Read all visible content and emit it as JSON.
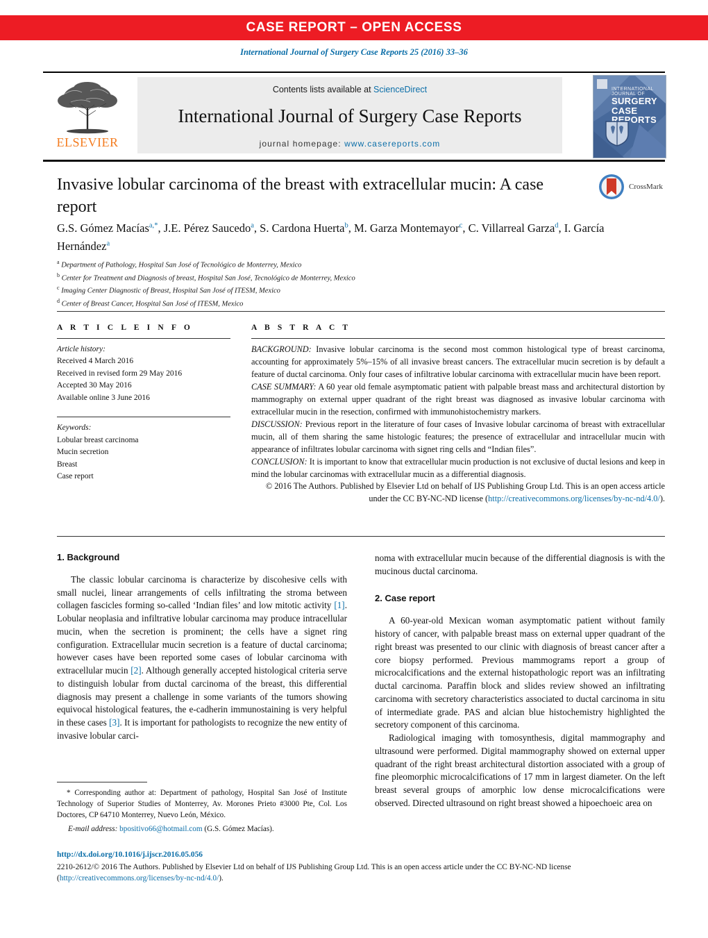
{
  "banner": {
    "text": "CASE REPORT – OPEN ACCESS"
  },
  "journal_ref": "International Journal of Surgery Case Reports 25 (2016) 33–36",
  "masthead": {
    "publisher_name": "ELSEVIER",
    "contents_prefix": "Contents lists available at ",
    "contents_link": "ScienceDirect",
    "journal_name": "International Journal of Surgery Case Reports",
    "homepage_prefix": "journal homepage: ",
    "homepage_link": "www.casereports.com",
    "cover": {
      "line1": "INTERNATIONAL",
      "line2": "JOURNAL OF",
      "line3": "SURGERY",
      "line4": "CASE",
      "line5": "REPORTS"
    }
  },
  "article": {
    "title": "Invasive lobular carcinoma of the breast with extracellular mucin: A case report",
    "crossmark_label": "CrossMark",
    "authors_html": "G.S. Gómez Macías<sup>a,</sup><sup>*</sup>, J.E. Pérez Saucedo<sup>a</sup>, S. Cardona Huerta<sup>b</sup>, M. Garza Montemayor<sup>c</sup>, C. Villarreal Garza<sup>d</sup>, I. García Hernández<sup>a</sup>",
    "affiliations": [
      {
        "marker": "a",
        "text": "Department of Pathology, Hospital San José of Tecnológico de Monterrey, Mexico"
      },
      {
        "marker": "b",
        "text": "Center for Treatment and Diagnosis of breast, Hospital San José, Tecnológico de Monterrey, Mexico"
      },
      {
        "marker": "c",
        "text": "Imaging Center Diagnostic of Breast, Hospital San José of ITESM, Mexico"
      },
      {
        "marker": "d",
        "text": "Center of Breast Cancer, Hospital San José of ITESM, Mexico"
      }
    ]
  },
  "article_info": {
    "heading": "A R T I C L E    I N F O",
    "history_label": "Article history:",
    "history": [
      "Received 4 March 2016",
      "Received in revised form 29 May 2016",
      "Accepted 30 May 2016",
      "Available online 3 June 2016"
    ],
    "keywords_label": "Keywords:",
    "keywords": [
      "Lobular breast carcinoma",
      "Mucin secretion",
      "Breast",
      "Case report"
    ]
  },
  "abstract": {
    "heading": "A B S T R A C T",
    "background_tag": "BACKGROUND:",
    "background_text": " Invasive lobular carcinoma is the second most common histological type of breast carcinoma, accounting for approximately 5%–15% of all invasive breast cancers. The extracellular mucin secretion is by default a feature of ductal carcinoma. Only four cases of infiltrative lobular carcinoma with extracellular mucin have been report.",
    "case_summary_tag": "CASE SUMMARY:",
    "case_summary_text": " A 60 year old female asymptomatic patient with palpable breast mass and architectural distortion by mammography on external upper quadrant of the right breast was diagnosed as invasive lobular carcinoma with extracellular mucin in the resection, confirmed with immunohistochemistry markers.",
    "discussion_tag": "DISCUSSION:",
    "discussion_text": " Previous report in the literature of four cases of Invasive lobular carcinoma of breast with extracellular mucin, all of them sharing the same histologic features; the presence of extracellular and intracellular mucin with appearance of infiltrates lobular carcinoma with signet ring cells and “Indian files”.",
    "conclusion_tag": "CONCLUSION:",
    "conclusion_text": " It is important to know that extracellular mucin production is not exclusive of ductal lesions and keep in mind the lobular carcinomas with extracellular mucin as a differential diagnosis.",
    "copyright_text": "© 2016 The Authors. Published by Elsevier Ltd on behalf of IJS Publishing Group Ltd. This is an open access article under the CC BY-NC-ND license (",
    "copyright_link": "http://creativecommons.org/licenses/by-nc-nd/4.0/",
    "copyright_tail": ")."
  },
  "body": {
    "section1_heading": "1. Background",
    "section1_p1_part1": "The classic lobular carcinoma is characterize by discohesive cells with small nuclei, linear arrangements of cells infiltrating the stroma between collagen fascicles forming so-called ‘Indian files’ and low mitotic activity ",
    "ref1": "[1]",
    "section1_p1_part2": ". Lobular neoplasia and infiltrative lobular carcinoma may produce intracellular mucin, when the secretion is prominent; the cells have a signet ring configuration. Extracellular mucin secretion is a feature of ductal carcinoma; however cases have been reported some cases of lobular carcinoma with extracellular mucin ",
    "ref2": "[2]",
    "section1_p1_part3": ". Although generally accepted histological criteria serve to distinguish lobular from ductal carcinoma of the breast, this differential diagnosis may present a challenge in some variants of the tumors showing equivocal histological features, the e-cadherin immunostaining is very helpful in these cases ",
    "ref3": "[3]",
    "section1_p1_part4": ". It is important for pathologists to recognize the new entity of invasive lobular carcinoma with extracellular mucin because of the differential diagnosis is with the mucinous ductal carcinoma.",
    "right_col_continuation": "noma with extracellular mucin because of the differential diagnosis is with the mucinous ductal carcinoma.",
    "section2_heading": "2. Case report",
    "section2_p1": "A 60-year-old Mexican woman asymptomatic patient without family history of cancer, with palpable breast mass on external upper quadrant of the right breast was presented to our clinic with diagnosis of breast cancer after a core biopsy performed. Previous mammograms report a group of microcalcifications and the external histopathologic report was an infiltrating ductal carcinoma. Paraffin block and slides review showed an infiltrating carcinoma with secretory characteristics associated to ductal carcinoma in situ of intermediate grade. PAS and alcian blue histochemistry highlighted the secretory component of this carcinoma.",
    "section2_p2": "Radiological imaging with tomosynthesis, digital mammography and ultrasound were performed. Digital mammography showed on external upper quadrant of the right breast architectural distortion associated with a group of fine pleomorphic microcalcifications of 17 mm in largest diameter. On the left breast several groups of amorphic low dense microcalcifications were observed. Directed ultrasound on right breast showed a hipoechoeic area on"
  },
  "footnote": {
    "star_text": "* Corresponding author at: Department of pathology, Hospital San José of Institute Technology of Superior Studies of Monterrey, Av. Morones Prieto #3000 Pte, Col. Los Doctores, CP 64710 Monterrey, Nuevo León, México.",
    "email_label": "E-mail address:",
    "email": "bpositivo66@hotmail.com",
    "email_attrib": " (G.S. Gómez Macías)."
  },
  "bottom": {
    "doi": "http://dx.doi.org/10.1016/j.ijscr.2016.05.056",
    "issn_text": "2210-2612/© 2016 The Authors. Published by Elsevier Ltd on behalf of IJS Publishing Group Ltd. This is an open access article under the CC BY-NC-ND license (",
    "license_link_part1": "http://",
    "license_link_part2": "creativecommons.org/licenses/by-nc-nd/4.0/",
    "tail": ")."
  },
  "colors": {
    "banner_red": "#ed1c24",
    "link_blue": "#0b6ea8",
    "elsevier_orange": "#f47c20",
    "cover_blue": "#4f6f9e"
  }
}
